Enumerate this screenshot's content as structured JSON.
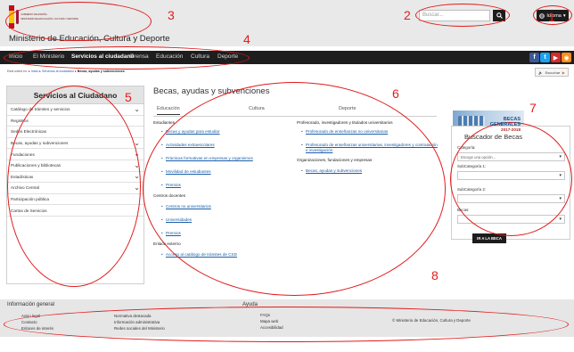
{
  "header": {
    "logo_text": [
      "GOBIERNO DE ESPAÑA",
      "MINISTERIO DE EDUCACIÓN, CULTURA Y DEPORTE"
    ],
    "ministry_name": "Ministerio de Educación, Cultura y Deporte",
    "search_placeholder": "Buscar...",
    "language_label": "Idioma",
    "colors": {
      "header_bg": "#e9e9e9",
      "nav_bg": "#1e1e1e"
    }
  },
  "nav": {
    "items": [
      "Inicio",
      "El Ministerio",
      "Servicios al ciudadano",
      "Prensa",
      "Educación",
      "Cultura",
      "Deporte"
    ],
    "active_index": 2,
    "social_icons": [
      "facebook-icon",
      "twitter-icon",
      "youtube-icon",
      "rss-icon"
    ]
  },
  "breadcrumb": {
    "prefix": "Está usted en:",
    "items": [
      "Inicio",
      "Servicios al ciudadano",
      "Becas, ayudas y subvenciones"
    ],
    "listen_label": "Escuchar"
  },
  "sidebar": {
    "title": "Servicios al Ciudadano",
    "items": [
      {
        "label": "Catálogo de trámites y servicios",
        "expandable": true
      },
      {
        "label": "Registros",
        "expandable": false
      },
      {
        "label": "Sedes Electrónicas",
        "expandable": false
      },
      {
        "label": "Becas, ayudas y subvenciones",
        "expandable": true
      },
      {
        "label": "Fundaciones",
        "expandable": true
      },
      {
        "label": "Publicaciones y bibliotecas",
        "expandable": true
      },
      {
        "label": "Estadísticas",
        "expandable": true
      },
      {
        "label": "Archivo Central",
        "expandable": true
      },
      {
        "label": "Participación pública",
        "expandable": false
      },
      {
        "label": "Cartas de Servicios",
        "expandable": false
      }
    ]
  },
  "main": {
    "title": "Becas, ayudas y subvenciones",
    "tabs": [
      "Educación",
      "Cultura",
      "Deporte"
    ],
    "left_column": {
      "sections": [
        {
          "heading": "Estudiantes",
          "links": [
            "Becas y ayudas para estudiar",
            "Actividades extraescolares",
            "Prácticas formativas en empresas y organismos",
            "Movilidad de estudiantes",
            "Premios"
          ]
        },
        {
          "heading": "Centros docentes",
          "links": [
            "Centros no universitarios",
            "Universidades",
            "Premios"
          ]
        },
        {
          "heading": "Enlace externo",
          "links": [
            "Acceso al catálogo de trámites de CSD"
          ]
        }
      ]
    },
    "right_column": {
      "sections": [
        {
          "heading": "Profesorado, investigadores y titulados universitarios",
          "links": [
            "Profesorado de enseñanzas no universitarias",
            "Profesorado de enseñanzas universitarias, investigadores y contratación e investigación"
          ]
        },
        {
          "heading": "Organizaciones, fundaciones y empresas",
          "links": [
            "Becas, ayudas y subvenciones"
          ]
        }
      ]
    }
  },
  "banner": {
    "line1": "BECAS",
    "line2": "GENERALES",
    "line3": "2017-2018"
  },
  "buscador": {
    "title": "Buscador de Becas",
    "categoria_label": "Categoría:",
    "categoria_value": "Escoge una opción...",
    "sub1_label": "SubCategoría 1:",
    "sub2_label": "SubCategoría 2:",
    "becas_label": "Becas:",
    "button_label": "IR A LA BECA"
  },
  "footer": {
    "col1": {
      "heading": "Información general",
      "links": [
        "Aviso legal",
        "Contacto",
        "Enlaces de interés"
      ]
    },
    "col2": {
      "links": [
        "Normativa destacada",
        "Información administrativa",
        "Redes sociales del Ministerio"
      ]
    },
    "col3": {
      "heading": "Ayuda",
      "links": [
        "FAQs",
        "Mapa web",
        "Accesibilidad"
      ]
    },
    "copyright": "© Ministerio de Educación, Cultura y Deporte"
  },
  "annotations": {
    "labels": [
      "1",
      "2",
      "3",
      "4",
      "5",
      "6",
      "7",
      "8"
    ],
    "color": "#e21b1b"
  }
}
